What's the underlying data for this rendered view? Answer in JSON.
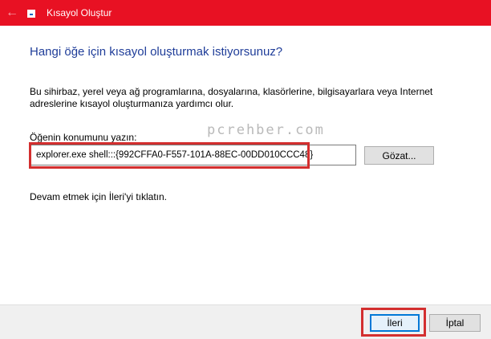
{
  "window": {
    "title": "Kısayol Oluştur",
    "back_icon": "arrow-left-icon",
    "app_icon": "shortcut-icon",
    "accent_color": "#e81123"
  },
  "content": {
    "heading": "Hangi öğe için kısayol oluşturmak istiyorsunuz?",
    "description": "Bu sihirbaz, yerel veya ağ programlarına, dosyalarına, klasörlerine, bilgisayarlara veya Internet adreslerine kısayol oluşturmanıza yardımcı olur.",
    "location_label": "Öğenin konumunu yazın:",
    "location_value": "explorer.exe shell:::{992CFFA0-F557-101A-88EC-00DD010CCC48}",
    "browse_label": "Gözat...",
    "instruction": "Devam etmek için İleri'yi tıklatın.",
    "watermark": "pcrehber.com"
  },
  "footer": {
    "next_label": "İleri",
    "cancel_label": "İptal"
  },
  "highlight_color": "#d32f2f"
}
